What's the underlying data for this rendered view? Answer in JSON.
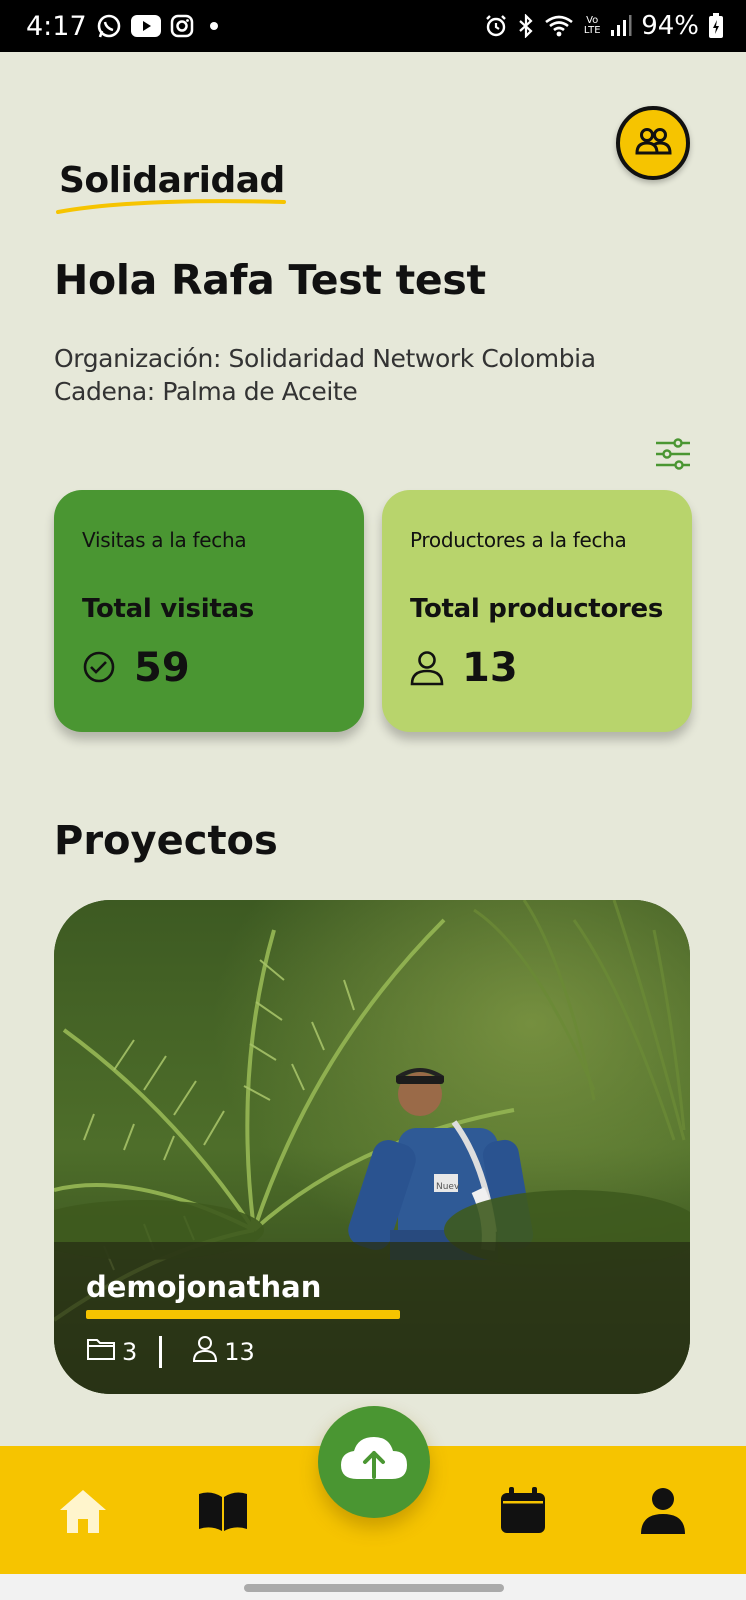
{
  "status_bar": {
    "time": "4:17",
    "battery_percent": "94%",
    "left_icons": [
      "whatsapp-icon",
      "youtube-icon",
      "instagram-icon",
      "dot-icon"
    ],
    "right_icons": [
      "alarm-icon",
      "bluetooth-icon",
      "wifi-icon",
      "volte-icon",
      "signal-icon",
      "battery-charging-icon"
    ],
    "volte_label": "Vo LTE"
  },
  "header": {
    "brand": "Solidaridad",
    "group_button_icon": "users-icon"
  },
  "greeting": "Hola Rafa Test test",
  "organization_line": "Organización: Solidaridad Network Colombia",
  "chain_line": "Cadena: Palma de Aceite",
  "filter_icon": "sliders-icon",
  "cards": {
    "visits": {
      "caption": "Visitas a la fecha",
      "heading": "Total visitas",
      "value": "59",
      "icon": "check-circle-icon",
      "color": "#4a9632"
    },
    "producers": {
      "caption": "Productores a la fecha",
      "heading": "Total productores",
      "value": "13",
      "icon": "user-icon",
      "color": "#b8d46c"
    }
  },
  "projects_title": "Proyectos",
  "project": {
    "name": "demojonathan",
    "folders": "3",
    "users": "13",
    "photo_badge_text": "Nuev"
  },
  "bottom_nav": {
    "items": [
      {
        "icon": "home-icon",
        "active": true
      },
      {
        "icon": "book-icon",
        "active": false
      },
      {
        "icon": "cloud-upload-icon",
        "active": false
      },
      {
        "icon": "calendar-icon",
        "active": false
      },
      {
        "icon": "profile-icon",
        "active": false
      }
    ]
  },
  "colors": {
    "accent_yellow": "#f6c400",
    "brand_green": "#4a9632",
    "light_green": "#b8d46c",
    "background": "#e6e8d9"
  }
}
